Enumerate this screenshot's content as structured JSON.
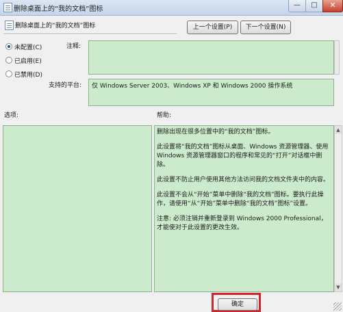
{
  "window": {
    "title": "删除桌面上的“我的文档”图标",
    "minimize_glyph": "—",
    "maximize_glyph": "□",
    "close_glyph": "✕"
  },
  "header": {
    "setting_name": "删除桌面上的“我的文档”图标",
    "prev_button": "上一个设置(P)",
    "next_button": "下一个设置(N)"
  },
  "state_options": [
    {
      "label": "未配置(C)",
      "checked": true
    },
    {
      "label": "已启用(E)",
      "checked": false
    },
    {
      "label": "已禁用(D)",
      "checked": false
    }
  ],
  "labels": {
    "comment": "注释:",
    "platform": "支持的平台:",
    "options": "选项:",
    "help": "帮助:"
  },
  "platform_text": "仅 Windows Server 2003、Windows XP 和 Windows 2000 操作系统",
  "help_paragraphs": [
    "删除出现在很多位置中的“我的文档”图标。",
    "此设置将“我的文档”图标从桌面、Windows 资源管理器、使用 Windows 资源管理器窗口的程序和常见的“打开”对话框中删除。",
    "此设置不防止用户使用其他方法访问我的文档文件夹中的内容。",
    "此设置不会从“开始”菜单中删除“我的文档”图标。要执行此操作，请使用“从“开始”菜单中删除“我的文档”图标”设置。",
    "注意: 必须注销并重新登录到 Windows 2000 Professional，才能使对于此设置的更改生效。"
  ],
  "footer": {
    "ok_button": "确定"
  },
  "colors": {
    "field_bg": "#ccebcc",
    "highlight": "#d2242c"
  },
  "icons": {
    "scroll_up": "▲",
    "scroll_down": "▼"
  }
}
